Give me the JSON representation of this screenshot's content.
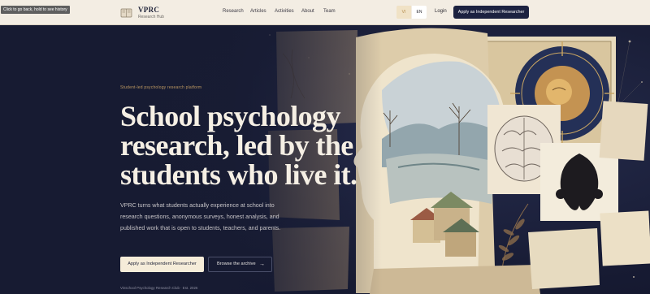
{
  "browser": {
    "tooltip": "Click to go back, hold to see history"
  },
  "header": {
    "brand": {
      "name": "VPRC",
      "subtitle": "Research Hub"
    },
    "nav": [
      "Research",
      "Articles",
      "Activities",
      "About",
      "Team"
    ],
    "languages": [
      "VI",
      "EN"
    ],
    "active_language": "EN",
    "login_label": "Login",
    "apply_label": "Apply as Independent Researcher"
  },
  "hero": {
    "eyebrow": "Student-led psychology research platform",
    "headline": [
      "School psychology",
      "research, led by the",
      "students who live it."
    ],
    "lead": "VPRC turns what students actually experience at school into research questions, anonymous surveys, honest analysis, and published work that is open to students, teachers, and parents.",
    "primary_cta": "Apply as Independent Researcher",
    "secondary_cta": "Browse the archive",
    "secondary_cta_icon": "arrow-right-icon",
    "footnote": "Vinschool Psychology Research Club · Est. 2026"
  },
  "colors": {
    "navy": "#1c2240",
    "cream": "#f5ecd9",
    "gold": "#bf9a62",
    "header_bg": "#f3ede3"
  }
}
